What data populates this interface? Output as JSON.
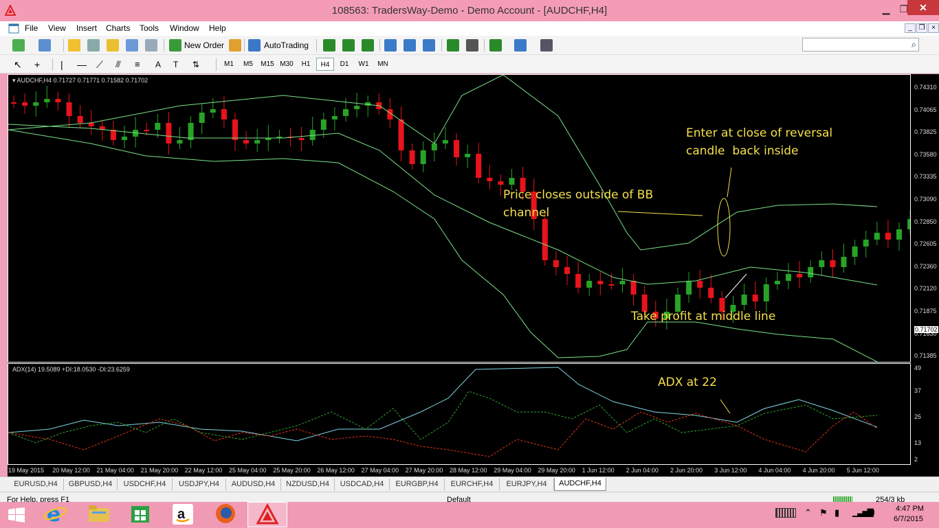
{
  "window": {
    "title": "108563: TradersWay-Demo - Demo Account - [AUDCHF,H4]",
    "minimize": "▁",
    "maximize": "❐",
    "close": "✕"
  },
  "menu": {
    "items": [
      "File",
      "View",
      "Insert",
      "Charts",
      "Tools",
      "Window",
      "Help"
    ]
  },
  "toolbar": {
    "new_order": "New Order",
    "autotrading": "AutoTrading",
    "search_placeholder": ""
  },
  "timeframes": [
    "M1",
    "M5",
    "M15",
    "M30",
    "H1",
    "H4",
    "D1",
    "W1",
    "MN"
  ],
  "active_timeframe": "H4",
  "chart": {
    "info": "AUDCHF,H4  0.71727 0.71771 0.71582 0.71702",
    "adx_info": "ADX(14) 19.5089 +DI:18.0530 -DI:23.6259",
    "price_labels": [
      "0.74310",
      "0.74065",
      "0.73825",
      "0.73580",
      "0.73335",
      "0.73090",
      "0.72850",
      "0.72605",
      "0.72360",
      "0.72120",
      "0.71875",
      "0.71630",
      "0.71385"
    ],
    "current_price": "0.71702",
    "adx_levels": [
      "49",
      "37",
      "25",
      "13",
      "2"
    ],
    "time_labels": [
      "19 May 2015",
      "20 May 12:00",
      "21 May 04:00",
      "21 May 20:00",
      "22 May 12:00",
      "25 May 04:00",
      "25 May 20:00",
      "26 May 12:00",
      "27 May 04:00",
      "27 May 20:00",
      "28 May 12:00",
      "29 May 04:00",
      "29 May 20:00",
      "1 Jun 12:00",
      "2 Jun 04:00",
      "2 Jun 20:00",
      "3 Jun 12:00",
      "4 Jun 04:00",
      "4 Jun 20:00",
      "5 Jun 12:00"
    ]
  },
  "annotations": {
    "enter": "Enter at close of reversal\ncandle  back inside",
    "price_closes": "Price closes outside of BB\nchannel",
    "take_profit": "Take profit at middle line",
    "adx": "ADX at 22"
  },
  "tabs": [
    "EURUSD,H4",
    "GBPUSD,H4",
    "USDCHF,H4",
    "USDJPY,H4",
    "AUDUSD,H4",
    "NZDUSD,H4",
    "USDCAD,H4",
    "EURGBP,H4",
    "EURCHF,H4",
    "EURJPY,H4",
    "AUDCHF,H4"
  ],
  "active_tab": "AUDCHF,H4",
  "status": {
    "help": "For Help, press F1",
    "profile": "Default",
    "traffic": "254/3 kb"
  },
  "taskbar": {
    "time": "4:47 PM",
    "date": "6/7/2015"
  },
  "colors": {
    "bull": "#27a327",
    "bear": "#e8131b",
    "bands": "#7be38a",
    "adx": "#7fd6e6",
    "plus_di": "#2fa82f",
    "minus_di": "#e8341c",
    "annotation": "#f5e04a"
  }
}
